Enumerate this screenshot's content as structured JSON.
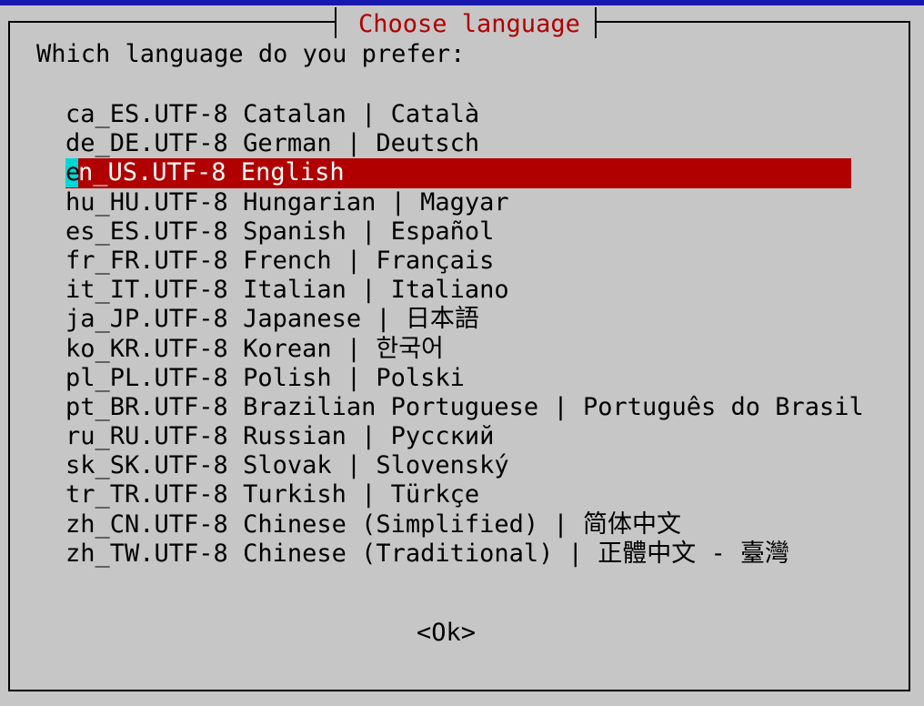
{
  "dialog": {
    "title": "Choose language",
    "prompt": "Which language do you prefer:"
  },
  "languages": [
    {
      "label": "ca_ES.UTF-8 Catalan | Català",
      "selected": false
    },
    {
      "label": "de_DE.UTF-8 German | Deutsch",
      "selected": false
    },
    {
      "label": "en_US.UTF-8 English",
      "selected": true
    },
    {
      "label": "hu_HU.UTF-8 Hungarian | Magyar",
      "selected": false
    },
    {
      "label": "es_ES.UTF-8 Spanish | Español",
      "selected": false
    },
    {
      "label": "fr_FR.UTF-8 French | Français",
      "selected": false
    },
    {
      "label": "it_IT.UTF-8 Italian | Italiano",
      "selected": false
    },
    {
      "label": "ja_JP.UTF-8 Japanese | 日本語",
      "selected": false
    },
    {
      "label": "ko_KR.UTF-8 Korean | 한국어",
      "selected": false
    },
    {
      "label": "pl_PL.UTF-8 Polish | Polski",
      "selected": false
    },
    {
      "label": "pt_BR.UTF-8 Brazilian Portuguese | Português do Brasil",
      "selected": false
    },
    {
      "label": "ru_RU.UTF-8 Russian | Русский",
      "selected": false
    },
    {
      "label": "sk_SK.UTF-8 Slovak | Slovenský",
      "selected": false
    },
    {
      "label": "tr_TR.UTF-8 Turkish | Türkçe",
      "selected": false
    },
    {
      "label": "zh_CN.UTF-8 Chinese (Simplified) | 简体中文",
      "selected": false
    },
    {
      "label": "zh_TW.UTF-8 Chinese (Traditional) | 正體中文 - 臺灣",
      "selected": false
    }
  ],
  "buttons": {
    "ok_label": "<Ok>"
  },
  "colors": {
    "background": "#c6c6c6",
    "top_bar": "#1818b0",
    "title_text": "#b00000",
    "selection_background": "#b00000",
    "selection_text": "#ffffff",
    "cursor": "#00d7d7"
  }
}
